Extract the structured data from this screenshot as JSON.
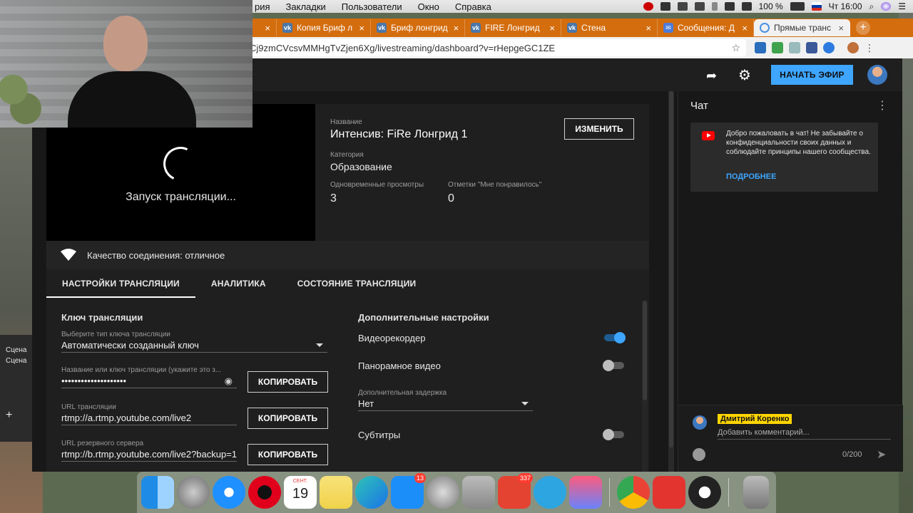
{
  "menubar": {
    "items": [
      "рия",
      "Закладки",
      "Пользователи",
      "Окно",
      "Справка"
    ],
    "battery": "100 %",
    "clock": "Чт 16:00"
  },
  "browser": {
    "tabs": [
      {
        "label": "Копия Бриф л",
        "icon": "vk-icon"
      },
      {
        "label": "Бриф лонгрид",
        "icon": "vk-icon"
      },
      {
        "label": "FIRE Лонгрид",
        "icon": "vk-icon"
      },
      {
        "label": "Стена",
        "icon": "vk-icon"
      },
      {
        "label": "Сообщения: Д",
        "icon": "messages-icon"
      },
      {
        "label": "Прямые транс",
        "icon": "loading-icon"
      }
    ],
    "url": "Cj9zmCVcsvMMHgTvZjen6Xg/livestreaming/dashboard?v=rHepgeGC1ZE"
  },
  "header": {
    "start_label": "НАЧАТЬ ЭФИР"
  },
  "stream": {
    "preview_status": "Запуск трансляции...",
    "title_label": "Название",
    "title": "Интенсив: FiRe Лонгрид 1",
    "category_label": "Категория",
    "category": "Образование",
    "viewers_label": "Одновременные просмотры",
    "viewers": "3",
    "likes_label": "Отметки \"Мне понравилось\"",
    "likes": "0",
    "edit_label": "ИЗМЕНИТЬ",
    "connection": "Качество соединения: отличное"
  },
  "tabs": [
    "НАСТРОЙКИ ТРАНСЛЯЦИИ",
    "АНАЛИТИКА",
    "СОСТОЯНИЕ ТРАНСЛЯЦИИ"
  ],
  "settings": {
    "key_section": "Ключ трансляции",
    "key_type_label": "Выберите тип ключа трансляции",
    "key_type": "Автоматически созданный ключ",
    "key_name_label": "Название или ключ трансляции (укажите это з...",
    "key_value": "••••••••••••••••••••",
    "url_label": "URL трансляции",
    "url_value": "rtmp://a.rtmp.youtube.com/live2",
    "backup_label": "URL резервного сервера",
    "backup_value": "rtmp://b.rtmp.youtube.com/live2?backup=1",
    "copy_label": "КОПИРОВАТЬ",
    "extra_section": "Дополнительные настройки",
    "dvr_label": "Видеорекордер",
    "dvr_on": true,
    "panorama_label": "Панорамное видео",
    "panorama_on": false,
    "delay_label": "Дополнительная задержка",
    "delay_value": "Нет",
    "subtitles_label": "Субтитры",
    "subtitles_on": false
  },
  "chat": {
    "title": "Чат",
    "welcome": "Добро пожаловать в чат! Не забывайте о конфиденциальности своих данных и соблюдайте принципы нашего сообщества.",
    "more": "ПОДРОБНЕЕ",
    "author": "Дмитрий Коренко",
    "placeholder": "Добавить комментарий...",
    "counter": "0/200"
  },
  "obs": {
    "scenes": [
      "Сцена",
      "Сцена"
    ]
  },
  "dock": {
    "calendar_month": "СЕНТ.",
    "calendar_day": "19",
    "appstore_badge": "13",
    "todoist_badge": "337"
  },
  "colors": {
    "accent": "#3ea6ff",
    "tabbar": "#d46d0e",
    "author_badge": "#ffd600"
  }
}
